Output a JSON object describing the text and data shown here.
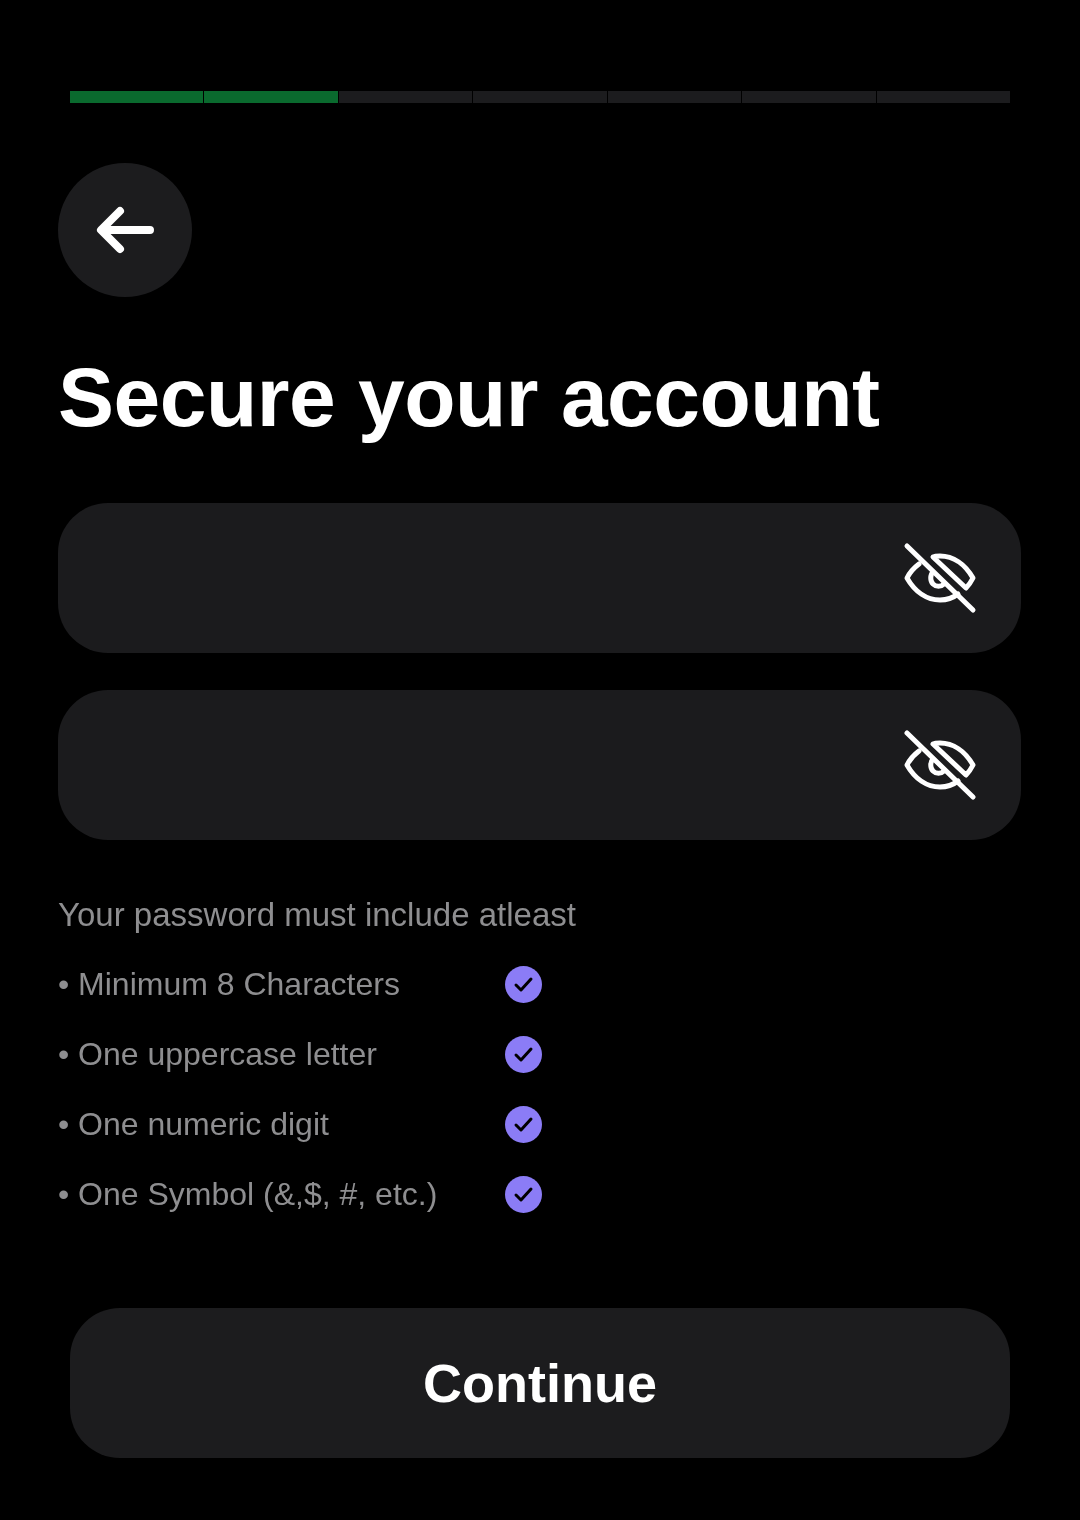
{
  "progress": {
    "segments": [
      {
        "done": true
      },
      {
        "done": true
      },
      {
        "done": false
      },
      {
        "done": false
      },
      {
        "done": false
      },
      {
        "done": false
      },
      {
        "done": false
      }
    ]
  },
  "title": "Secure your account",
  "fields": [
    {
      "revealed": false
    },
    {
      "revealed": false
    }
  ],
  "requirements": {
    "heading": "Your password must include atleast",
    "items": [
      {
        "text": "• Minimum 8 Characters",
        "met": true
      },
      {
        "text": "• One uppercase letter",
        "met": true
      },
      {
        "text": "• One numeric digit",
        "met": true
      },
      {
        "text": "• One Symbol (&,$, #, etc.)",
        "met": true
      }
    ]
  },
  "continue_button": "Continue"
}
